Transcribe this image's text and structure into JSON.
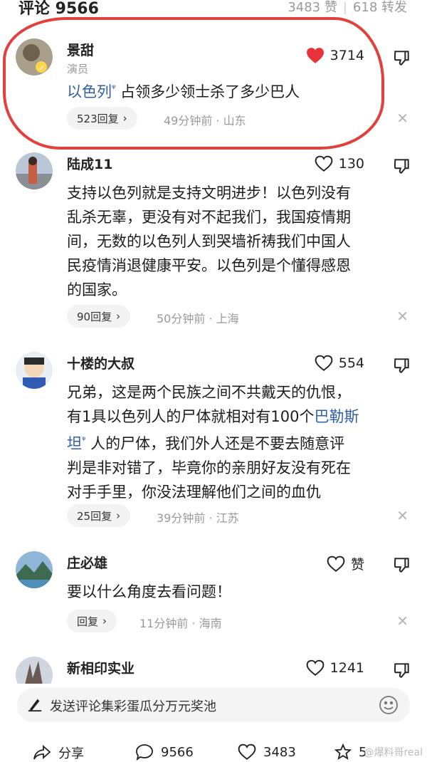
{
  "header": {
    "title": "评论 9566",
    "likes": "3483 赞",
    "shares": "618 转发"
  },
  "comments": [
    {
      "name": "景甜",
      "subtitle": "演员",
      "likes": "3714",
      "link": "以色列",
      "text": "占领多少领士杀了多少巴人",
      "reply": "523回复",
      "meta": "49分钟前 · 山东"
    },
    {
      "name": "陆成11",
      "likes": "130",
      "lines": [
        "支持以色列就是支持文明进步！以色列没有",
        "乱杀无辜，更没有对不起我们，我国疫情期",
        "间，无数的以色列人到哭墙祈祷我们中国人",
        "民疫情消退健康平安。以色列是个懂得感恩",
        "的国家。"
      ],
      "reply": "90回复",
      "meta": "50分钟前 · 上海"
    },
    {
      "name": "十楼的大叔",
      "likes": "554",
      "line1": "兄弟，这是两个民族之间不共戴天的仇恨，",
      "line2a": "有1具以色列人的尸体就相对有100个",
      "link": "巴勒斯",
      "line3a": "坦",
      "line3b": " 人的尸体，我们外人还是不要去随意评",
      "line4": "判是非对错了，毕竟你的亲朋好友没有死在",
      "line5": "对手手里，你没法理解他们之间的血仇",
      "reply": "25回复",
      "meta": "39分钟前 · 江苏"
    },
    {
      "name": "庄必雄",
      "likes": "赞",
      "text": "要以什么角度去看问题！",
      "reply": "回复",
      "meta": "11分钟前 · 海南"
    },
    {
      "name": "新相印实业",
      "likes": "1241"
    }
  ],
  "input": {
    "placeholder": "发送评论集彩蛋瓜分万元奖池"
  },
  "bottom": {
    "share": "分享",
    "comments": "9566",
    "likes": "3483",
    "fav": "5",
    "watermark": "@爆料哥real"
  },
  "colors": {
    "accent_red": "#e2403c",
    "link": "#2f5fa8"
  }
}
